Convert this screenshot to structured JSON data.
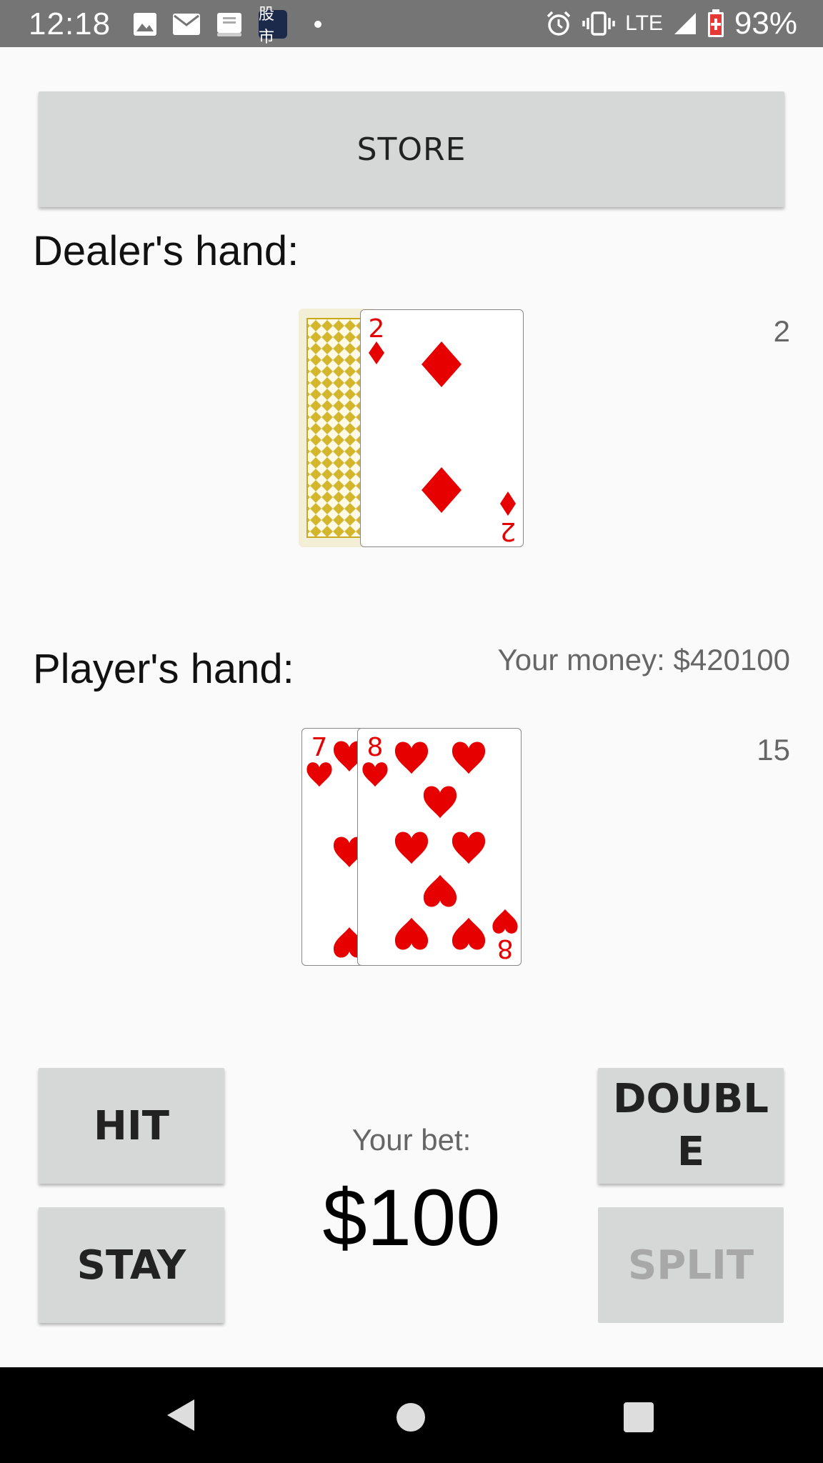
{
  "status_bar": {
    "time": "12:18",
    "network": "LTE",
    "battery": "93%",
    "app_icons": [
      "image-icon",
      "mail-icon",
      "bible-icon",
      "stock-market-icon"
    ],
    "stock_icon_text": "股市"
  },
  "store_button": "STORE",
  "dealer": {
    "label": "Dealer's hand:",
    "score": "2",
    "cards": [
      {
        "face_down": true
      },
      {
        "rank": "2",
        "suit": "diamonds"
      }
    ]
  },
  "player": {
    "label": "Player's hand:",
    "score": "15",
    "money": "Your money: $420100",
    "cards": [
      {
        "rank": "7",
        "suit": "hearts"
      },
      {
        "rank": "8",
        "suit": "hearts"
      }
    ]
  },
  "actions": {
    "hit": "HIT",
    "stay": "STAY",
    "double": "DOUBLE",
    "split": "SPLIT"
  },
  "bet": {
    "label": "Your bet:",
    "value": "$100"
  },
  "colors": {
    "card_red": "#e60000",
    "card_back": "#d4b62c",
    "button": "#d6d7d7"
  }
}
